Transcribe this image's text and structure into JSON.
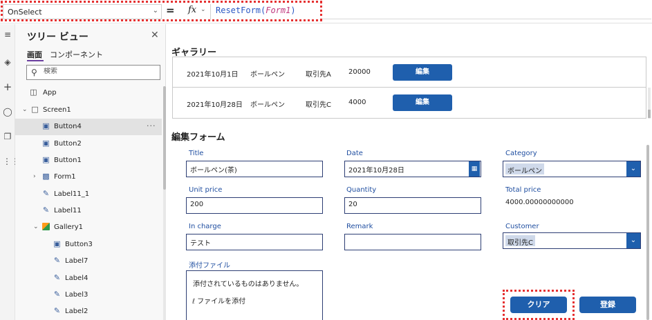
{
  "formula_bar": {
    "property": "OnSelect",
    "fx_label": "fx",
    "formula_fn": "ResetForm(",
    "formula_arg": "Form1",
    "formula_close": ")"
  },
  "tree": {
    "title": "ツリー ビュー",
    "tabs": [
      "画面",
      "コンポーネント"
    ],
    "search_placeholder": "検索",
    "items": [
      {
        "label": "App",
        "icon": "app-icon"
      },
      {
        "label": "Screen1",
        "icon": "screen-icon"
      },
      {
        "label": "Button4",
        "icon": "button-icon",
        "selected": true
      },
      {
        "label": "Button2",
        "icon": "button-icon"
      },
      {
        "label": "Button1",
        "icon": "button-icon"
      },
      {
        "label": "Form1",
        "icon": "form-icon"
      },
      {
        "label": "Label11_1",
        "icon": "label-icon"
      },
      {
        "label": "Label11",
        "icon": "label-icon"
      },
      {
        "label": "Gallery1",
        "icon": "gallery-icon"
      },
      {
        "label": "Button3",
        "icon": "button-icon"
      },
      {
        "label": "Label7",
        "icon": "label-icon"
      },
      {
        "label": "Label4",
        "icon": "label-icon"
      },
      {
        "label": "Label3",
        "icon": "label-icon"
      },
      {
        "label": "Label2",
        "icon": "label-icon"
      }
    ]
  },
  "gallery": {
    "title": "ギャラリー",
    "rows": [
      {
        "date": "2021年10月1日",
        "item": "ボールペン",
        "customer": "取引先A",
        "price": "20000",
        "button": "編集"
      },
      {
        "date": "2021年10月28日",
        "item": "ボールペン",
        "customer": "取引先C",
        "price": "4000",
        "button": "編集"
      }
    ]
  },
  "form": {
    "title": "編集フォーム",
    "title_label": "Title",
    "title_value": "ボールペン(茶)",
    "date_label": "Date",
    "date_value": "2021年10月28日",
    "category_label": "Category",
    "category_value": "ボールペン",
    "unit_price_label": "Unit price",
    "unit_price_value": "200",
    "quantity_label": "Quantity",
    "quantity_value": "20",
    "total_price_label": "Total price",
    "total_price_value": "4000.00000000000",
    "in_charge_label": "In charge",
    "in_charge_value": "テスト",
    "remark_label": "Remark",
    "remark_value": "",
    "customer_label": "Customer",
    "customer_value": "取引先C",
    "attachment_label": "添付ファイル",
    "attachment_empty": "添付されているものはありません。",
    "attachment_add": "ファイルを添付"
  },
  "buttons": {
    "clear": "クリア",
    "submit": "登録"
  },
  "colors": {
    "accent": "#1f5fad",
    "highlight": "#e53030",
    "field_label": "#1f4ea0",
    "formula_function": "#2b58c4",
    "formula_argument": "#c0397f"
  }
}
